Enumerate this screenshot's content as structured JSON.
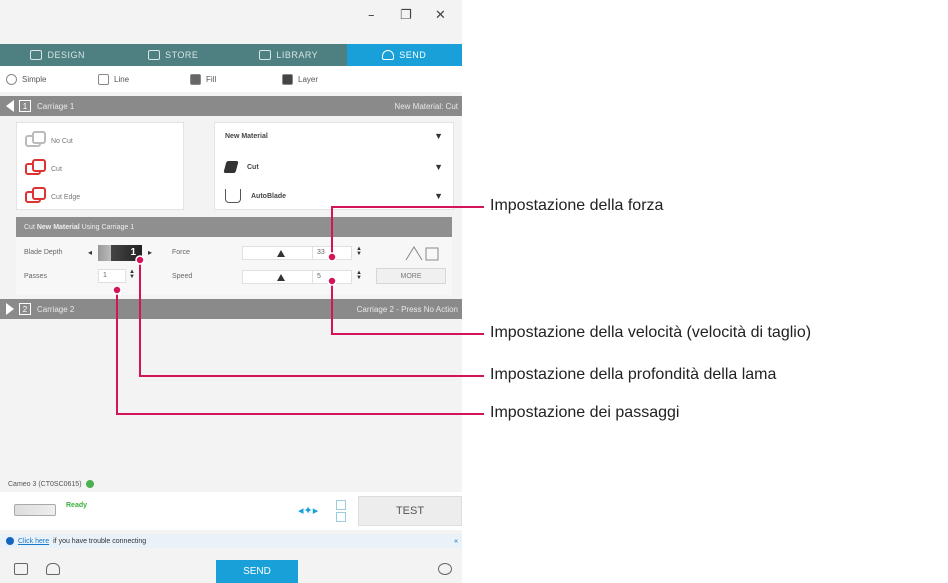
{
  "window": {
    "minimize": "–",
    "restore": "❐",
    "close": "✕"
  },
  "tabs": [
    {
      "label": "DESIGN"
    },
    {
      "label": "STORE"
    },
    {
      "label": "LIBRARY"
    },
    {
      "label": "SEND"
    }
  ],
  "modes": [
    {
      "label": "Simple"
    },
    {
      "label": "Line"
    },
    {
      "label": "Fill"
    },
    {
      "label": "Layer"
    }
  ],
  "carriage1": {
    "number": "1",
    "label": "Carriage 1",
    "right_text": "New Material: Cut"
  },
  "cut_options": [
    {
      "label": "No Cut"
    },
    {
      "label": "Cut"
    },
    {
      "label": "Cut Edge"
    }
  ],
  "selects": {
    "material": "New Material",
    "action": "Cut",
    "tool": "AutoBlade"
  },
  "cut_strip": {
    "prefix": "Cut",
    "material": "New Material",
    "suffix": "Using Carriage 1"
  },
  "settings": {
    "blade_depth_label": "Blade Depth",
    "blade_depth_value": "1",
    "passes_label": "Passes",
    "passes_value": "1",
    "force_label": "Force",
    "force_value": "33",
    "speed_label": "Speed",
    "speed_value": "5",
    "more_label": "MORE"
  },
  "carriage2": {
    "number": "2",
    "label": "Carriage 2",
    "right_text": "Carriage 2 - Press No Action"
  },
  "status": {
    "connection": "Cameo 3 (CT0SC0615)",
    "ready": "Ready"
  },
  "test_label": "TEST",
  "hint": {
    "link": "Click here",
    "text": "if you have trouble connecting",
    "edge": "«"
  },
  "send_label": "SEND",
  "callouts": {
    "force": "Impostazione della forza",
    "speed": "Impostazione della velocità (velocità di taglio)",
    "blade": "Impostazione della profondità della lama",
    "passes": "Impostazione dei passaggi"
  },
  "colors": {
    "accent": "#1aa0d8",
    "tab_bg": "#4e7f81",
    "callout_line": "#d4145a",
    "cut_red": "#dd3333"
  }
}
